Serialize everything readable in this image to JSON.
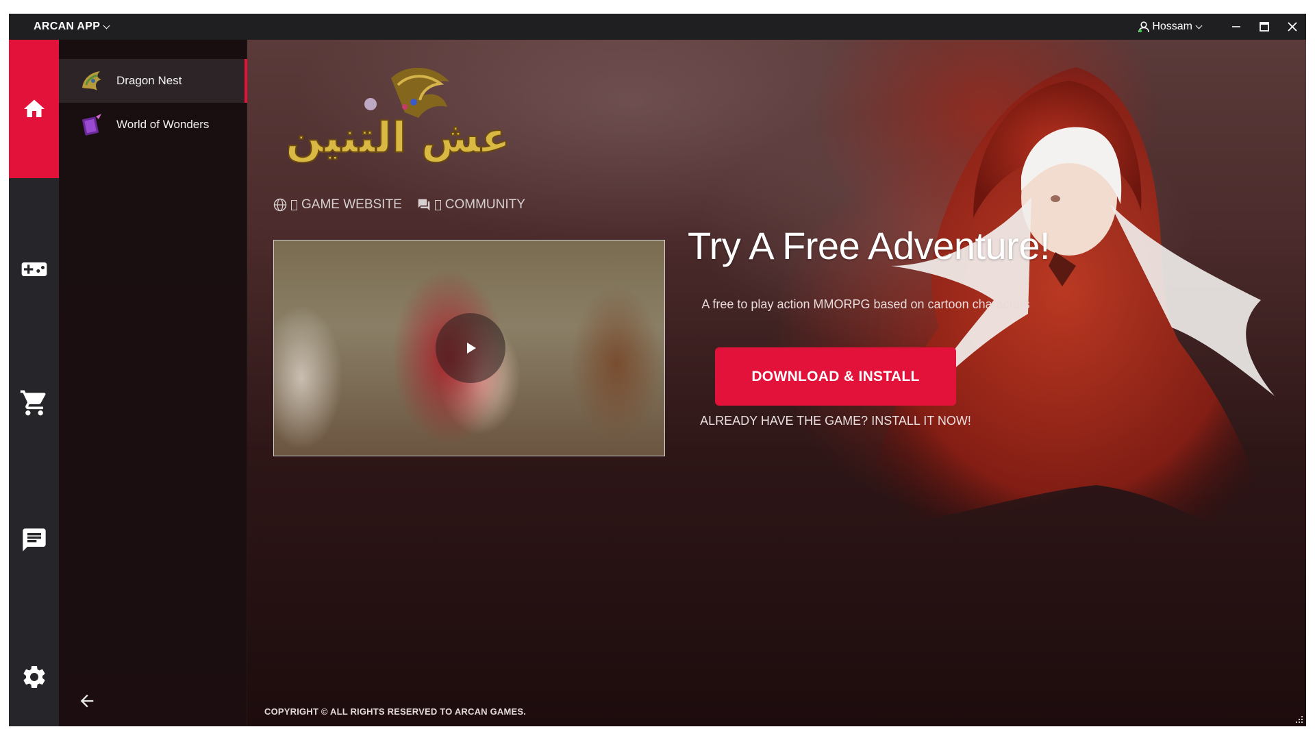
{
  "titlebar": {
    "app_name": "ARCAN APP",
    "user_name": "Hossam",
    "icons": [
      "user-icon",
      "chevron-down-icon",
      "minimize-icon",
      "maximize-icon",
      "close-icon"
    ]
  },
  "rail": {
    "items": [
      {
        "name": "home",
        "icon": "home-icon",
        "active": true
      },
      {
        "name": "games",
        "icon": "gamepad-icon"
      },
      {
        "name": "store",
        "icon": "cart-icon"
      },
      {
        "name": "chat",
        "icon": "chat-icon"
      },
      {
        "name": "settings",
        "icon": "gear-icon"
      }
    ],
    "accent": "#e2123a"
  },
  "gamelist": {
    "items": [
      {
        "label": "Dragon Nest",
        "icon": "dragon-nest-thumb",
        "selected": true
      },
      {
        "label": "World of Wonders",
        "icon": "world-of-wonders-thumb"
      }
    ],
    "back_icon": "arrow-left-icon"
  },
  "main": {
    "logo_text": "عش التنين",
    "links": {
      "website": "GAME WEBSITE",
      "community": "COMMUNITY"
    },
    "headline": "Try A Free Adventure!",
    "subline": "A free to play action MMORPG based on cartoon characters",
    "download_button": "DOWNLOAD & INSTALL",
    "install_link": "ALREADY HAVE THE GAME? INSTALL IT NOW!",
    "copyright": "COPYRIGHT © ALL RIGHTS RESERVED TO ARCAN GAMES."
  },
  "colors": {
    "accent": "#e2123a",
    "titlebar": "#1f1f22",
    "rail": "#26262a"
  }
}
